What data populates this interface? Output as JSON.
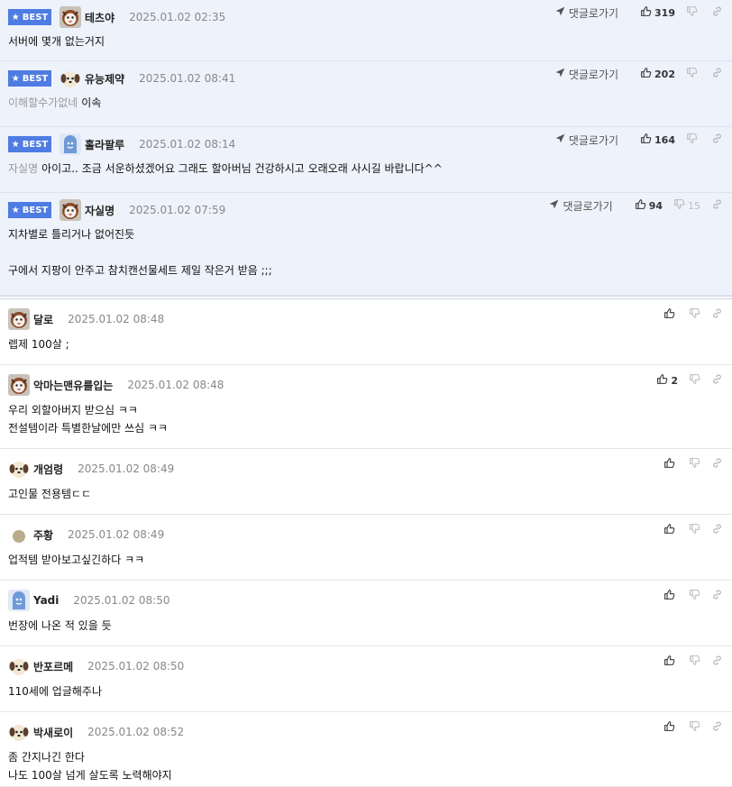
{
  "best_badge": "BEST",
  "reply_label": "댓글로가기",
  "best_comments": [
    {
      "nick": "테츠야",
      "date": "2025.01.02 02:35",
      "up": "319",
      "down": "",
      "avatar": "fox",
      "lines": [
        {
          "prefix": "",
          "text": "서버에 몇개 없는거지"
        }
      ]
    },
    {
      "nick": "유능제약",
      "date": "2025.01.02 08:41",
      "up": "202",
      "down": "",
      "avatar": "dog",
      "lines": [
        {
          "prefix": "이해할수가없네",
          "text": "이속"
        }
      ]
    },
    {
      "nick": "홀라팔루",
      "date": "2025.01.02 08:14",
      "up": "164",
      "down": "",
      "avatar": "blue",
      "lines": [
        {
          "prefix": "자실명",
          "text": "아이고.. 조금 서운하셨겠어요 그래도 할아버님 건강하시고 오래오래 사시길 바랍니다^^"
        }
      ]
    },
    {
      "nick": "자실명",
      "date": "2025.01.02 07:59",
      "up": "94",
      "down": "15",
      "avatar": "fox",
      "lines": [
        {
          "prefix": "",
          "text": "지차별로 틀리거나 없어진듯"
        },
        {
          "prefix": "",
          "text": ""
        },
        {
          "prefix": "",
          "text": "구에서 지팡이 안주고 참치캔선물세트 제일 작은거 받음 ;;;"
        }
      ]
    }
  ],
  "comments": [
    {
      "nick": "달로",
      "date": "2025.01.02 08:48",
      "up": "",
      "avatar": "fox",
      "lines": [
        "렙제 100살 ;"
      ]
    },
    {
      "nick": "악마는맨유를입는",
      "date": "2025.01.02 08:48",
      "up": "2",
      "avatar": "fox",
      "lines": [
        "우리 외할아버지 받으심 ㅋㅋ",
        "전설템이라 특별한날에만 쓰심 ㅋㅋ"
      ]
    },
    {
      "nick": "개엄령",
      "date": "2025.01.02 08:49",
      "up": "",
      "avatar": "dog",
      "lines": [
        "고인물 전용템ㄷㄷ"
      ]
    },
    {
      "nick": "주황",
      "date": "2025.01.02 08:49",
      "up": "",
      "avatar": "dot",
      "lines": [
        "업적템 받아보고싶긴하다 ㅋㅋ"
      ]
    },
    {
      "nick": "Yadi",
      "date": "2025.01.02 08:50",
      "up": "",
      "avatar": "blue",
      "lines": [
        "번장에 나온 적 있을 듯"
      ]
    },
    {
      "nick": "반포르메",
      "date": "2025.01.02 08:50",
      "up": "",
      "avatar": "dog",
      "lines": [
        "110세에 업글해주나"
      ]
    },
    {
      "nick": "박새로이",
      "date": "2025.01.02 08:52",
      "up": "",
      "avatar": "dog",
      "lines": [
        "좀 간지나긴 한다",
        "나도 100살 넘게 살도록 노력해야지"
      ]
    }
  ]
}
